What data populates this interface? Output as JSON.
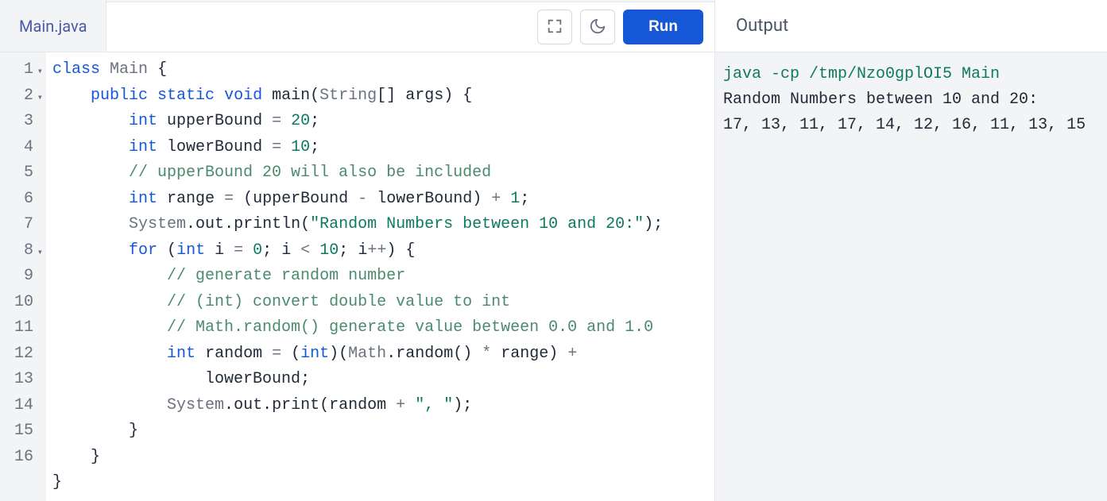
{
  "tab": {
    "filename": "Main.java"
  },
  "toolbar": {
    "run_label": "Run"
  },
  "gutter": {
    "lines": [
      "1",
      "2",
      "3",
      "4",
      "5",
      "6",
      "7",
      "8",
      "9",
      "10",
      "11",
      "12",
      "",
      "13",
      "14",
      "15",
      "16"
    ],
    "fold_rows": [
      0,
      1,
      7
    ]
  },
  "code": {
    "lines": [
      [
        {
          "t": "kw",
          "v": "class"
        },
        {
          "t": "sp",
          "v": " "
        },
        {
          "t": "cls",
          "v": "Main"
        },
        {
          "t": "sp",
          "v": " "
        },
        {
          "t": "punc",
          "v": "{"
        }
      ],
      [
        {
          "t": "sp",
          "v": "    "
        },
        {
          "t": "kw",
          "v": "public"
        },
        {
          "t": "sp",
          "v": " "
        },
        {
          "t": "kw",
          "v": "static"
        },
        {
          "t": "sp",
          "v": " "
        },
        {
          "t": "kw",
          "v": "void"
        },
        {
          "t": "sp",
          "v": " "
        },
        {
          "t": "id",
          "v": "main"
        },
        {
          "t": "punc",
          "v": "("
        },
        {
          "t": "t-string",
          "v": "String"
        },
        {
          "t": "punc",
          "v": "[]"
        },
        {
          "t": "sp",
          "v": " "
        },
        {
          "t": "id",
          "v": "args"
        },
        {
          "t": "punc",
          "v": ")"
        },
        {
          "t": "sp",
          "v": " "
        },
        {
          "t": "punc",
          "v": "{"
        }
      ],
      [
        {
          "t": "sp",
          "v": "        "
        },
        {
          "t": "type",
          "v": "int"
        },
        {
          "t": "sp",
          "v": " "
        },
        {
          "t": "id",
          "v": "upperBound"
        },
        {
          "t": "sp",
          "v": " "
        },
        {
          "t": "op",
          "v": "="
        },
        {
          "t": "sp",
          "v": " "
        },
        {
          "t": "num",
          "v": "20"
        },
        {
          "t": "punc",
          "v": ";"
        }
      ],
      [
        {
          "t": "sp",
          "v": "        "
        },
        {
          "t": "type",
          "v": "int"
        },
        {
          "t": "sp",
          "v": " "
        },
        {
          "t": "id",
          "v": "lowerBound"
        },
        {
          "t": "sp",
          "v": " "
        },
        {
          "t": "op",
          "v": "="
        },
        {
          "t": "sp",
          "v": " "
        },
        {
          "t": "num",
          "v": "10"
        },
        {
          "t": "punc",
          "v": ";"
        }
      ],
      [
        {
          "t": "sp",
          "v": "        "
        },
        {
          "t": "cmt",
          "v": "// upperBound 20 will also be included"
        }
      ],
      [
        {
          "t": "sp",
          "v": "        "
        },
        {
          "t": "type",
          "v": "int"
        },
        {
          "t": "sp",
          "v": " "
        },
        {
          "t": "id",
          "v": "range"
        },
        {
          "t": "sp",
          "v": " "
        },
        {
          "t": "op",
          "v": "="
        },
        {
          "t": "sp",
          "v": " "
        },
        {
          "t": "punc",
          "v": "("
        },
        {
          "t": "id",
          "v": "upperBound"
        },
        {
          "t": "sp",
          "v": " "
        },
        {
          "t": "op",
          "v": "-"
        },
        {
          "t": "sp",
          "v": " "
        },
        {
          "t": "id",
          "v": "lowerBound"
        },
        {
          "t": "punc",
          "v": ")"
        },
        {
          "t": "sp",
          "v": " "
        },
        {
          "t": "op",
          "v": "+"
        },
        {
          "t": "sp",
          "v": " "
        },
        {
          "t": "num",
          "v": "1"
        },
        {
          "t": "punc",
          "v": ";"
        }
      ],
      [
        {
          "t": "sp",
          "v": "        "
        },
        {
          "t": "cls",
          "v": "System"
        },
        {
          "t": "punc",
          "v": "."
        },
        {
          "t": "id",
          "v": "out"
        },
        {
          "t": "punc",
          "v": "."
        },
        {
          "t": "id",
          "v": "println"
        },
        {
          "t": "punc",
          "v": "("
        },
        {
          "t": "str",
          "v": "\"Random Numbers between 10 and 20:\""
        },
        {
          "t": "punc",
          "v": ");"
        }
      ],
      [
        {
          "t": "sp",
          "v": "        "
        },
        {
          "t": "kw",
          "v": "for"
        },
        {
          "t": "sp",
          "v": " "
        },
        {
          "t": "punc",
          "v": "("
        },
        {
          "t": "type",
          "v": "int"
        },
        {
          "t": "sp",
          "v": " "
        },
        {
          "t": "id",
          "v": "i"
        },
        {
          "t": "sp",
          "v": " "
        },
        {
          "t": "op",
          "v": "="
        },
        {
          "t": "sp",
          "v": " "
        },
        {
          "t": "num",
          "v": "0"
        },
        {
          "t": "punc",
          "v": ";"
        },
        {
          "t": "sp",
          "v": " "
        },
        {
          "t": "id",
          "v": "i"
        },
        {
          "t": "sp",
          "v": " "
        },
        {
          "t": "op",
          "v": "<"
        },
        {
          "t": "sp",
          "v": " "
        },
        {
          "t": "num",
          "v": "10"
        },
        {
          "t": "punc",
          "v": ";"
        },
        {
          "t": "sp",
          "v": " "
        },
        {
          "t": "id",
          "v": "i"
        },
        {
          "t": "op",
          "v": "++"
        },
        {
          "t": "punc",
          "v": ")"
        },
        {
          "t": "sp",
          "v": " "
        },
        {
          "t": "punc",
          "v": "{"
        }
      ],
      [
        {
          "t": "sp",
          "v": "            "
        },
        {
          "t": "cmt",
          "v": "// generate random number"
        }
      ],
      [
        {
          "t": "sp",
          "v": "            "
        },
        {
          "t": "cmt",
          "v": "// (int) convert double value to int"
        }
      ],
      [
        {
          "t": "sp",
          "v": "            "
        },
        {
          "t": "cmt",
          "v": "// Math.random() generate value between 0.0 and 1.0"
        }
      ],
      [
        {
          "t": "sp",
          "v": "            "
        },
        {
          "t": "type",
          "v": "int"
        },
        {
          "t": "sp",
          "v": " "
        },
        {
          "t": "id",
          "v": "random"
        },
        {
          "t": "sp",
          "v": " "
        },
        {
          "t": "op",
          "v": "="
        },
        {
          "t": "sp",
          "v": " "
        },
        {
          "t": "punc",
          "v": "("
        },
        {
          "t": "type",
          "v": "int"
        },
        {
          "t": "punc",
          "v": ")("
        },
        {
          "t": "cls",
          "v": "Math"
        },
        {
          "t": "punc",
          "v": "."
        },
        {
          "t": "id",
          "v": "random"
        },
        {
          "t": "punc",
          "v": "()"
        },
        {
          "t": "sp",
          "v": " "
        },
        {
          "t": "op",
          "v": "*"
        },
        {
          "t": "sp",
          "v": " "
        },
        {
          "t": "id",
          "v": "range"
        },
        {
          "t": "punc",
          "v": ")"
        },
        {
          "t": "sp",
          "v": " "
        },
        {
          "t": "op",
          "v": "+"
        }
      ],
      [
        {
          "t": "sp",
          "v": "                "
        },
        {
          "t": "id",
          "v": "lowerBound"
        },
        {
          "t": "punc",
          "v": ";"
        }
      ],
      [
        {
          "t": "sp",
          "v": "            "
        },
        {
          "t": "cls",
          "v": "System"
        },
        {
          "t": "punc",
          "v": "."
        },
        {
          "t": "id",
          "v": "out"
        },
        {
          "t": "punc",
          "v": "."
        },
        {
          "t": "id",
          "v": "print"
        },
        {
          "t": "punc",
          "v": "("
        },
        {
          "t": "id",
          "v": "random"
        },
        {
          "t": "sp",
          "v": " "
        },
        {
          "t": "op",
          "v": "+"
        },
        {
          "t": "sp",
          "v": " "
        },
        {
          "t": "str",
          "v": "\", \""
        },
        {
          "t": "punc",
          "v": ");"
        }
      ],
      [
        {
          "t": "sp",
          "v": "        "
        },
        {
          "t": "punc",
          "v": "}"
        }
      ],
      [
        {
          "t": "sp",
          "v": "    "
        },
        {
          "t": "punc",
          "v": "}"
        }
      ],
      [
        {
          "t": "punc",
          "v": "}"
        }
      ]
    ]
  },
  "output": {
    "title": "Output",
    "command": "java -cp /tmp/Nzo0gplOI5 Main",
    "lines": [
      "Random Numbers between 10 and 20:",
      "17, 13, 11, 17, 14, 12, 16, 11, 13, 15"
    ]
  }
}
